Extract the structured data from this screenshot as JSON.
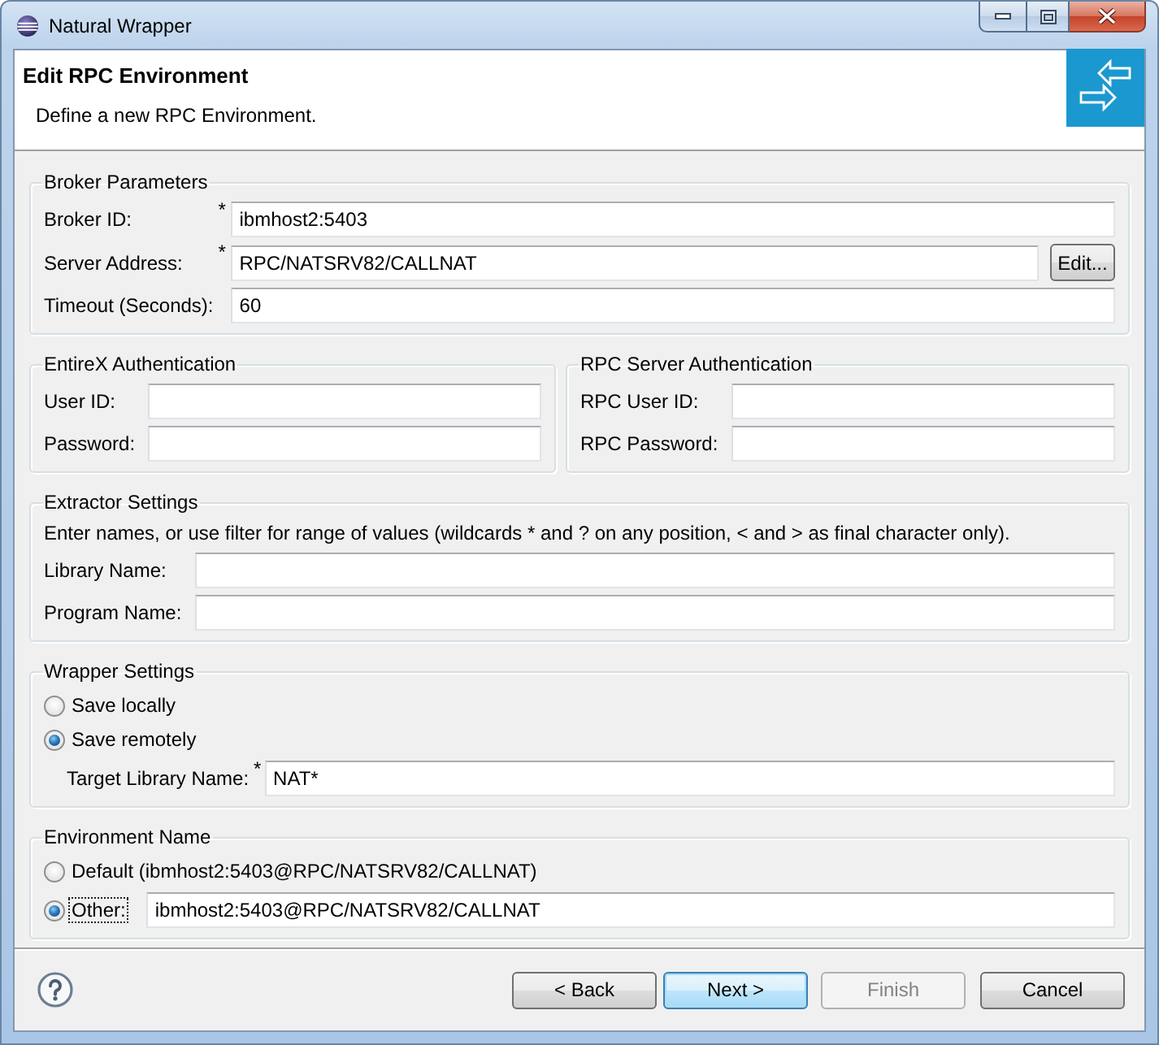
{
  "window": {
    "title": "Natural Wrapper"
  },
  "header": {
    "title": "Edit RPC Environment",
    "description": "Define a new RPC Environment."
  },
  "broker_parameters": {
    "title": "Broker Parameters",
    "fields": [
      {
        "label": "Broker ID:",
        "marker": "*",
        "value": "ibmhost2:5403"
      },
      {
        "label": "Server Address:",
        "marker": "*",
        "value": "RPC/NATSRV82/CALLNAT",
        "button": {
          "label": "Edit..."
        }
      },
      {
        "label": "Timeout (Seconds):",
        "value": "60"
      }
    ]
  },
  "authentication": [
    {
      "title": "EntireX Authentication",
      "fields": [
        {
          "label": "User ID:"
        },
        {
          "label": "Password:"
        }
      ]
    },
    {
      "title": "RPC Server Authentication",
      "fields": [
        {
          "label": "RPC User ID:"
        },
        {
          "label": "RPC Password:"
        }
      ]
    }
  ],
  "extractor_settings": {
    "title": "Extractor Settings",
    "hint": "Enter names, or use filter for range of values (wildcards * and ? on any position, < and > as final character only).",
    "fields": [
      {
        "label": "Library Name:"
      },
      {
        "label": "Program Name:"
      }
    ]
  },
  "wrapper_settings": {
    "title": "Wrapper Settings",
    "options": [
      {
        "label": "Save locally",
        "selected": false
      },
      {
        "label": "Save remotely",
        "selected": true
      }
    ],
    "target": {
      "label": "Target Library Name:",
      "marker": "*",
      "value": "NAT*"
    }
  },
  "environment_name": {
    "title": "Environment Name",
    "options": [
      {
        "label": "Default (ibmhost2:5403@RPC/NATSRV82/CALLNAT)",
        "selected": false,
        "focused": false
      },
      {
        "label": "Other:",
        "selected": true,
        "focused": true,
        "value": "ibmhost2:5403@RPC/NATSRV82/CALLNAT"
      }
    ]
  },
  "buttons": [
    {
      "label": "< Back",
      "default": false,
      "disabled": false
    },
    {
      "label": "Next >",
      "default": true,
      "disabled": false
    },
    {
      "label": "Finish",
      "default": false,
      "disabled": true
    },
    {
      "label": "Cancel",
      "default": false,
      "disabled": false
    }
  ]
}
